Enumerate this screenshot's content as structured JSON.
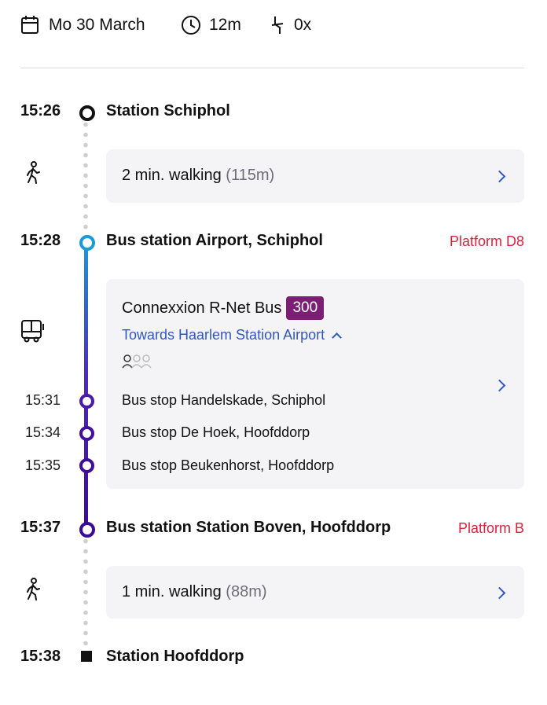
{
  "header": {
    "date": "Mo 30 March",
    "duration": "12m",
    "transfers": "0x"
  },
  "journey": {
    "origin": {
      "time": "15:26",
      "name": "Station Schiphol"
    },
    "walk1": {
      "text": "2 min. walking",
      "distance": "(115m)"
    },
    "board": {
      "time": "15:28",
      "name": "Bus station Airport, Schiphol",
      "platform": "Platform D8"
    },
    "bus": {
      "operator": "Connexxion R-Net Bus",
      "line": "300",
      "direction": "Towards Haarlem Station Airport",
      "crowding_level": 1,
      "stops": [
        {
          "time": "15:31",
          "name": "Bus stop Handelskade, Schiphol"
        },
        {
          "time": "15:34",
          "name": "Bus stop De Hoek, Hoofddorp"
        },
        {
          "time": "15:35",
          "name": "Bus stop Beukenhorst, Hoofddorp"
        }
      ]
    },
    "alight": {
      "time": "15:37",
      "name": "Bus station Station Boven, Hoofddorp",
      "platform": "Platform B"
    },
    "walk2": {
      "text": "1 min. walking",
      "distance": "(88m)"
    },
    "destination": {
      "time": "15:38",
      "name": "Station Hoofddorp"
    }
  },
  "colors": {
    "platform": "#d8233f",
    "line_badge": "#7b1e74",
    "link": "#2f56c4",
    "line_start": "#1a9ad6",
    "line_end": "#3a0a96"
  }
}
